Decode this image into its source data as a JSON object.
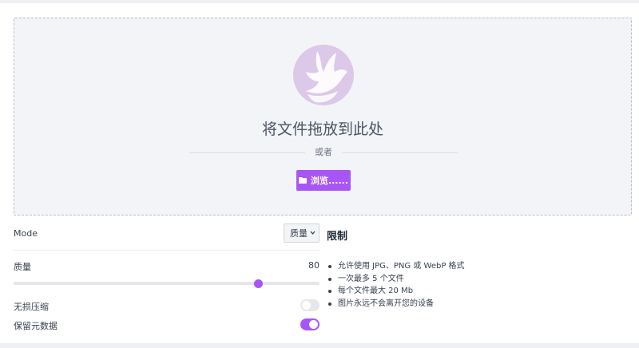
{
  "dropzone": {
    "title": "将文件拖放到此处",
    "or_text": "或者",
    "browse_label": "浏览......"
  },
  "settings": {
    "mode_label": "Mode",
    "mode_selected": "质量",
    "quality_label": "质量",
    "quality_value": "80",
    "quality_level": 80,
    "quality_max": 100,
    "lossless_label": "无损压缩",
    "lossless_on": false,
    "keep_metadata_label": "保留元数据",
    "keep_metadata_on": true
  },
  "limits": {
    "title": "限制",
    "items": [
      "允许使用 JPG、PNG 或 WebP 格式",
      "一次最多 5 个文件",
      "每个文件最大 20 Mb",
      "图片永远不会离开您的设备"
    ]
  },
  "colors": {
    "accent": "#a855f7",
    "logo_bg": "#dcc8e8",
    "dropzone_bg": "#f3f4f8"
  },
  "icons": {
    "logo": "bird-logo-icon",
    "browse": "folder-icon",
    "select": "chevron-down-icon"
  }
}
